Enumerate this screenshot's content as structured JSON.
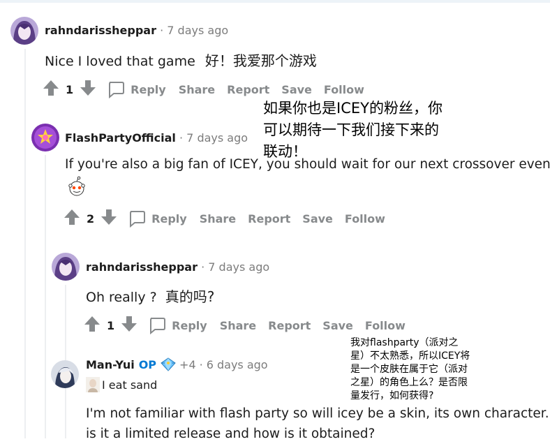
{
  "actions": {
    "reply": "Reply",
    "share": "Share",
    "report": "Report",
    "save": "Save",
    "follow": "Follow"
  },
  "comments": [
    {
      "username": "rahndarissheppar",
      "separator": "·",
      "time": "7 days ago",
      "text": "Nice I loved that game",
      "translation_inline": "好！我爱那个游戏",
      "votes": "1"
    },
    {
      "username": "FlashPartyOfficial",
      "separator": "·",
      "time": "7 days ago",
      "text": "If you're also a big fan of ICEY, you should wait for our next crossover event!",
      "votes": "2"
    },
    {
      "username": "rahndarissheppar",
      "separator": "·",
      "time": "7 days ago",
      "text": "Oh really ?",
      "translation_inline": "真的吗?",
      "votes": "1"
    },
    {
      "username": "Man-Yui",
      "op_badge": "OP",
      "karma": "+4",
      "separator": "·",
      "time": "6 days ago",
      "flair": "I eat sand",
      "text_line1": "I'm not familiar with flash party so will icey be a skin, its own character.",
      "text_line2": "is it a limited release and how is it obtained?"
    }
  ],
  "annotations": {
    "flashparty_translation": [
      "如果你也是ICEY的粉丝，你",
      "可以期待一下我们接下来的",
      "联动！"
    ],
    "manyui_translation": [
      "我对flashparty（派对之",
      "星）不太熟悉，所以ICEY将",
      "是一个皮肤在属于它（派对",
      "之星）的角色上么？是否限",
      "量发行，如何获得?"
    ]
  },
  "colors": {
    "text": "#1c1c1c",
    "muted": "#878a8c",
    "time": "#7c7c7c",
    "op": "#0079d3",
    "thread_line": "#edeff1"
  }
}
